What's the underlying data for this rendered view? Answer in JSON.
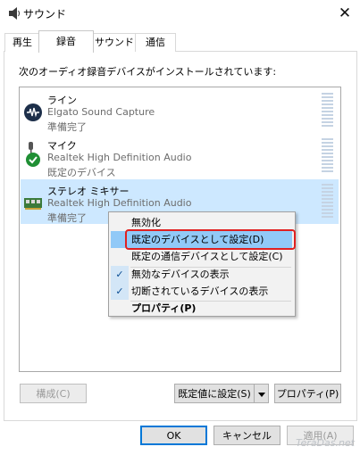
{
  "window": {
    "title": "サウンド",
    "close_glyph": "✕"
  },
  "tabs": [
    {
      "label": "再生",
      "active": false
    },
    {
      "label": "録音",
      "active": true
    },
    {
      "label": "サウンド",
      "active": false
    },
    {
      "label": "通信",
      "active": false
    }
  ],
  "instruction": "次のオーディオ録音デバイスがインストールされています:",
  "devices": [
    {
      "name": "ライン",
      "driver": "Elgato Sound Capture",
      "status": "準備完了",
      "icon": "elgato-icon",
      "selected": false
    },
    {
      "name": "マイク",
      "driver": "Realtek High Definition Audio",
      "status": "既定のデバイス",
      "icon": "microphone-icon",
      "selected": false
    },
    {
      "name": "ステレオ ミキサー",
      "driver": "Realtek High Definition Audio",
      "status": "準備完了",
      "icon": "sound-card-icon",
      "selected": true
    }
  ],
  "context_menu": {
    "items": [
      {
        "label": "無効化",
        "checked": false,
        "highlighted": false,
        "bold": false
      },
      {
        "label": "既定のデバイスとして設定(D)",
        "checked": false,
        "highlighted": true,
        "bold": false
      },
      {
        "label": "既定の通信デバイスとして設定(C)",
        "checked": false,
        "highlighted": false,
        "bold": false
      },
      {
        "label": "無効なデバイスの表示",
        "checked": true,
        "highlighted": false,
        "bold": false
      },
      {
        "label": "切断されているデバイスの表示",
        "checked": true,
        "highlighted": false,
        "bold": false
      },
      {
        "label": "プロパティ(P)",
        "checked": false,
        "highlighted": false,
        "bold": true
      }
    ],
    "check_glyph": "✓"
  },
  "buttons": {
    "configure": "構成(C)",
    "set_default": "既定値に設定(S)",
    "properties": "プロパティ(P)",
    "ok": "OK",
    "cancel": "キャンセル",
    "apply": "適用(A)"
  },
  "watermark": "TeraDas.net",
  "colors": {
    "selection": "#cde8ff",
    "menu_highlight": "#91c9f7",
    "annotation_ring": "#e02020",
    "default_check": "#1f8f34"
  }
}
